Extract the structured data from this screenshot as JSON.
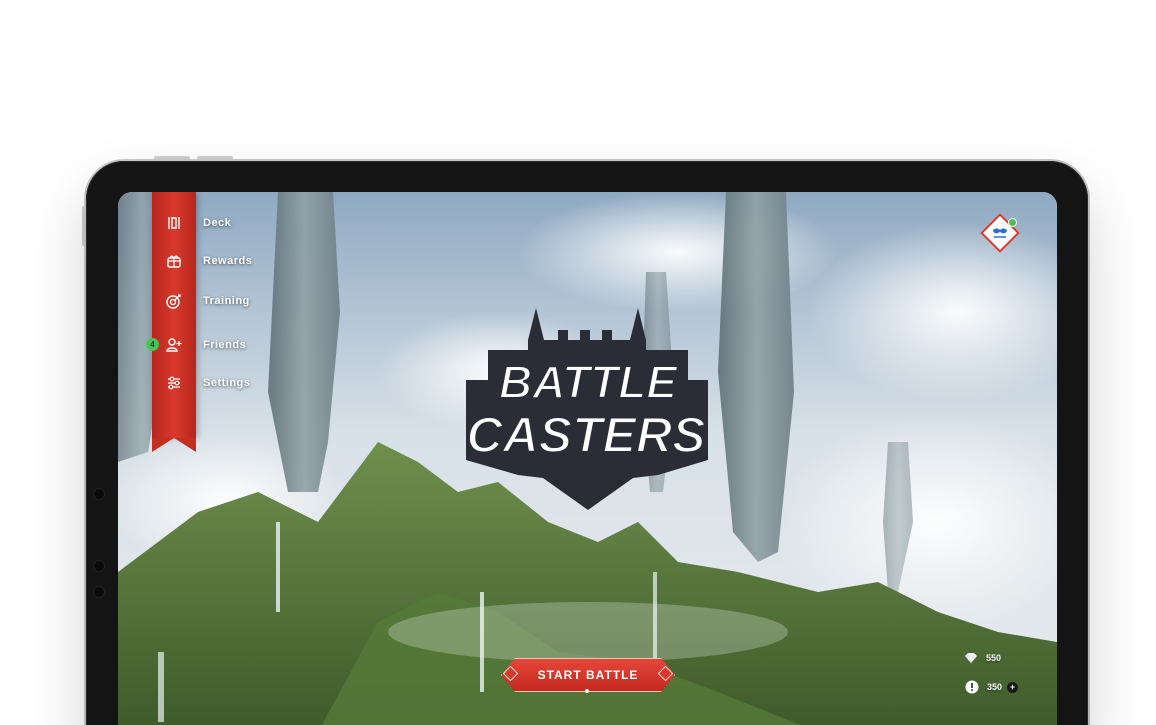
{
  "app": {
    "title": "BATTLE CASTERS",
    "logo_lines": [
      "BATTLE",
      "CASTERS"
    ]
  },
  "menu": {
    "items": [
      {
        "label": "Deck",
        "icon": "cards-icon"
      },
      {
        "label": "Rewards",
        "icon": "gift-icon"
      },
      {
        "label": "Training",
        "icon": "target-icon"
      },
      {
        "label": "Friends",
        "icon": "add-user-icon"
      },
      {
        "label": "Settings",
        "icon": "sliders-icon"
      }
    ],
    "friends_badge": "4"
  },
  "profile": {
    "icon": "mask-icon"
  },
  "start_battle": {
    "label": "START BATTLE"
  },
  "currency": {
    "gems": "550",
    "coins": "350",
    "gem_icon": "gem-icon",
    "coin_icon": "coin-icon",
    "add_icon": "plus-icon"
  },
  "colors": {
    "accent_red": "#d8382c",
    "badge_green": "#49c45a",
    "logo_dark": "#2a2d36"
  }
}
